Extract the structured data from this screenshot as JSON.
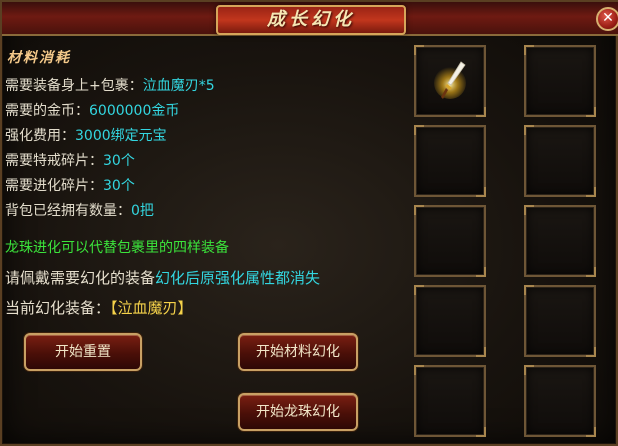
{
  "window": {
    "title": "成长幻化",
    "close_glyph": "✕"
  },
  "materials": {
    "heading": "材料消耗",
    "rows": [
      {
        "label": "需要装备身上+包裹：",
        "value": "泣血魔刃*5"
      },
      {
        "label": "需要的金币：",
        "value": "6000000金币"
      },
      {
        "label": "强化费用：",
        "value": "3000绑定元宝"
      },
      {
        "label": "需要特戒碎片：",
        "value": "30个"
      },
      {
        "label": "需要进化碎片：",
        "value": "30个"
      },
      {
        "label": "背包已经拥有数量：",
        "value": "0把"
      }
    ]
  },
  "notes": {
    "dragon_pearl_note": "龙珠进化可以代替包裹里的四样装备",
    "wear_prefix": "请佩戴需要幻化的装备",
    "wear_warning": "幻化后原强化属性都消失",
    "current_label": "当前幻化装备：",
    "current_value": "【泣血魔刃】"
  },
  "buttons": {
    "reset": "开始重置",
    "material_transform": "开始材料幻化",
    "dragon_transform": "开始龙珠幻化"
  },
  "slots": {
    "filled_index": 0,
    "filled_item_icon": "blade-weapon-icon",
    "count": 10
  },
  "colors": {
    "value_cyan": "#33d6e0",
    "note_green": "#3be33b",
    "current_yellow": "#f5d24a",
    "frame_gold": "#c8a064",
    "title_red": "#c2361d"
  }
}
